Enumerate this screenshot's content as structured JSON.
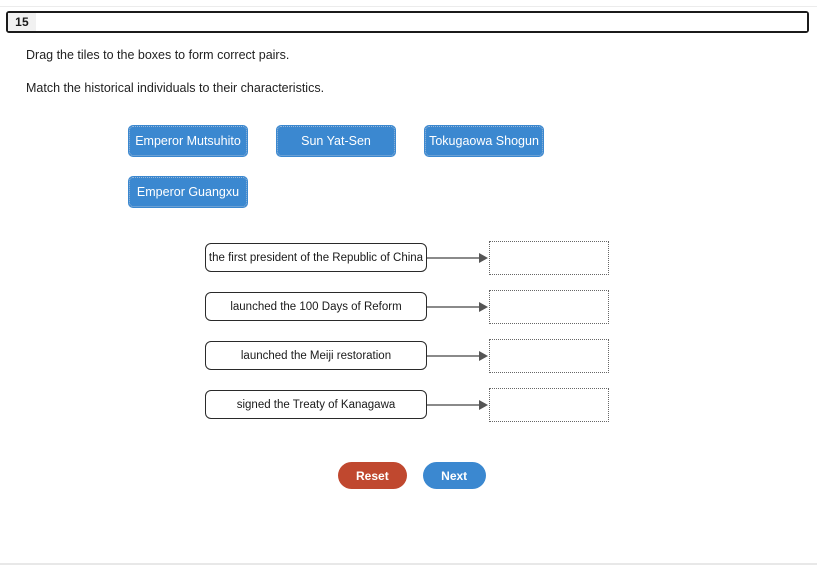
{
  "question": {
    "number": "15",
    "instruction": "Drag the tiles to the boxes to form correct pairs.",
    "prompt": "Match the historical individuals to their characteristics."
  },
  "tiles": [
    {
      "label": "Emperor Mutsuhito"
    },
    {
      "label": "Sun Yat-Sen"
    },
    {
      "label": "Tokugaowa Shogun"
    },
    {
      "label": "Emperor Guangxu"
    }
  ],
  "matches": [
    {
      "prompt": "the first president of the Republic of China",
      "answer": ""
    },
    {
      "prompt": "launched the 100 Days of Reform",
      "answer": ""
    },
    {
      "prompt": "launched the Meiji restoration",
      "answer": ""
    },
    {
      "prompt": "signed the Treaty of Kanagawa",
      "answer": ""
    }
  ],
  "buttons": {
    "reset": "Reset",
    "next": "Next"
  },
  "colors": {
    "tile_blue": "#3b88d0",
    "reset_red": "#c0482f",
    "next_blue": "#3b88d0",
    "box_border": "#2a2a2a",
    "drop_border": "#666666",
    "arrow": "#8a8a8a"
  },
  "icons": {
    "arrow": "arrow-right-icon"
  }
}
